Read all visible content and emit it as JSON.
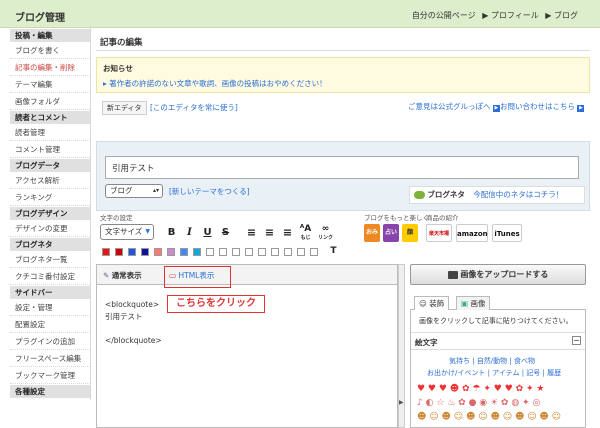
{
  "header": {
    "title": "ブログ管理",
    "nav": [
      "自分の公開ページ",
      "▶ プロフィール",
      "▶ ブログ"
    ]
  },
  "sidebar": {
    "sections": [
      {
        "title": "投稿・編集",
        "items": [
          "ブログを書く",
          "記事の編集・削除",
          "テーマ編集",
          "画像フォルダ"
        ]
      },
      {
        "title": "読者とコメント",
        "items": [
          "読者管理",
          "コメント管理"
        ]
      },
      {
        "title": "ブログデータ",
        "items": [
          "アクセス解析",
          "ランキング"
        ]
      },
      {
        "title": "ブログデザイン",
        "items": [
          "デザインの変更"
        ]
      },
      {
        "title": "ブログネタ",
        "items": [
          "ブログネタ一覧",
          "クチコミ番付設定"
        ]
      },
      {
        "title": "サイドバー",
        "items": [
          "設定・管理",
          "配置設定",
          "プラグインの追加",
          "フリースペース編集",
          "ブックマーク管理"
        ]
      },
      {
        "title": "各種設定",
        "items": []
      }
    ]
  },
  "main": {
    "page_title": "記事の編集",
    "notice": {
      "heading": "お知らせ",
      "body": "▸ 著作者の許諾のない文章や歌詞、画像の投稿はおやめください！"
    },
    "editor_tag": "新エディタ",
    "always_use_link": "[このエディタを常に使う]",
    "feedback_link": "ご意見は公式グルっぽへ",
    "contact_link": "お問い合わせはこちら",
    "post_title": "引用テスト",
    "theme_select": "ブログ",
    "new_theme_link": "[新しいテーマをつくる]",
    "neta_label": "ブログネタ",
    "neta_link": "今配信中のネタはコチラ！",
    "toolbar": {
      "label_font": "文字の設定",
      "font_size": "文字サイズ",
      "bold": "B",
      "italic": "I",
      "underline": "U",
      "strike": "S",
      "label_more": "ブログをもっと楽しく",
      "label_products": "商品の紹介",
      "ruby": "もじ",
      "link": "リンク"
    },
    "tabs": {
      "normal": "通常表示",
      "html": "HTML表示"
    },
    "code_lines": [
      "<blockquote>",
      "引用テスト",
      "",
      "</blockquote>"
    ],
    "callout": "こちらをクリック",
    "upload_button": "画像をアップロードする",
    "right_tabs": {
      "decoration": "装飾",
      "image": "画像"
    },
    "image_hint": "画像をクリックして記事に貼りつけてください。",
    "emoji_title": "絵文字",
    "emoji_categories_1": "気持ち | 自然/動物 | 食べ物",
    "emoji_categories_2": "お出かけ/イベント | アイテム | 記号 | 履歴"
  },
  "colors": {
    "accent": "#2a6fd6",
    "header": "#ddeecc",
    "callout": "#dd3333",
    "swatches": [
      "#ee1111",
      "#cc0000",
      "#2255dd",
      "#111199",
      "#ff7777",
      "#cc88cc",
      "#4488ff",
      "#11aadd"
    ]
  }
}
